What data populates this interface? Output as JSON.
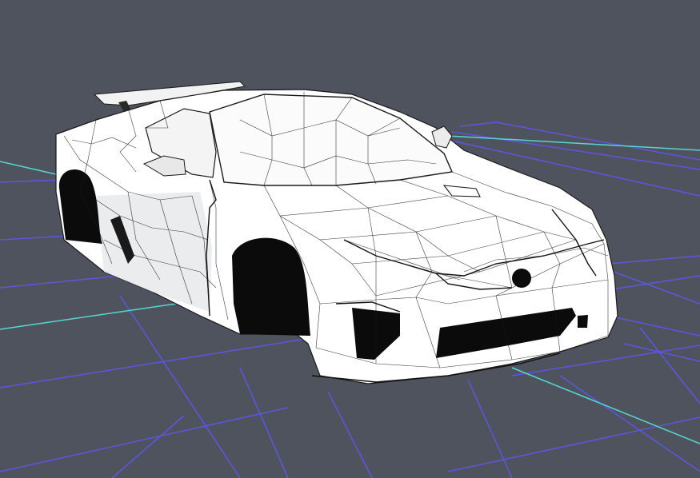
{
  "viewport": {
    "background_color": "#4e535e",
    "grid_line_color": "#5f56e0",
    "grid_axis_color": "#57d6d0",
    "model_fill_color": "#ffffff",
    "model_shadow_color": "#e3e4e8",
    "model_wire_color": "#1a1a1a",
    "model_cavity_color": "#0b0b0b",
    "object": "wireframe-car-model"
  }
}
